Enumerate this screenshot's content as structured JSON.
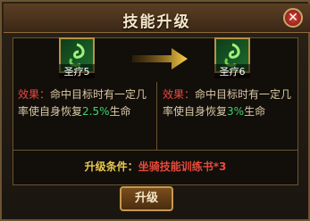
{
  "window": {
    "title": "技能升级",
    "close_icon": "close-icon"
  },
  "current_skill": {
    "name": "圣疗5",
    "icon": "swirl-skill-icon"
  },
  "next_skill": {
    "name": "圣疗6",
    "icon": "swirl-skill-icon"
  },
  "arrow": {
    "icon": "arrow-right-icon"
  },
  "current_effect": {
    "label": "效果：",
    "text": "命中目标时有一定几率使自身恢复",
    "pct": "2.5%",
    "suffix": "生命"
  },
  "next_effect": {
    "label": "效果：",
    "text": "命中目标时有一定几率使自身恢复",
    "pct": "3%",
    "suffix": "生命"
  },
  "condition": {
    "label": "升级条件：",
    "value": "坐骑技能训练书*3"
  },
  "upgrade_button": {
    "label": "升级"
  },
  "colors": {
    "effect_label": "#e84b3c",
    "percent": "#3cd46a",
    "condition_label": "#e9c94f",
    "condition_value": "#e84b3c"
  }
}
